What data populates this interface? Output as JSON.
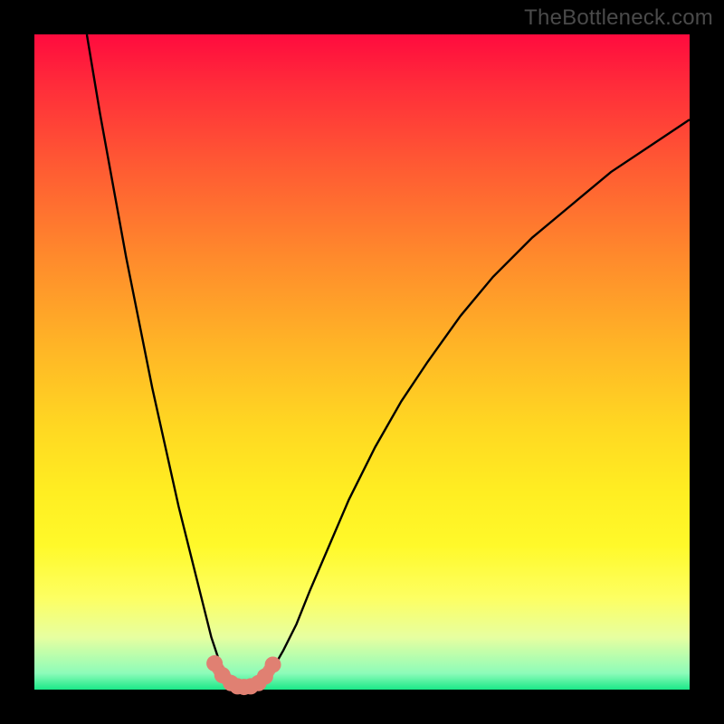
{
  "watermark": "TheBottleneck.com",
  "chart_data": {
    "type": "line",
    "title": "",
    "xlabel": "",
    "ylabel": "",
    "xlim": [
      0,
      100
    ],
    "ylim": [
      0,
      100
    ],
    "grid": false,
    "series": [
      {
        "name": "left-branch",
        "x": [
          8,
          10,
          12,
          14,
          16,
          18,
          20,
          22,
          24,
          26,
          27,
          28,
          29,
          30
        ],
        "y": [
          100,
          88,
          77,
          66,
          56,
          46,
          37,
          28,
          20,
          12,
          8,
          5,
          2.5,
          1
        ]
      },
      {
        "name": "right-branch",
        "x": [
          35,
          36,
          38,
          40,
          42,
          45,
          48,
          52,
          56,
          60,
          65,
          70,
          76,
          82,
          88,
          94,
          100
        ],
        "y": [
          1,
          2.5,
          6,
          10,
          15,
          22,
          29,
          37,
          44,
          50,
          57,
          63,
          69,
          74,
          79,
          83,
          87
        ]
      },
      {
        "name": "salmon-dots",
        "x": [
          27.5,
          28.7,
          30.0,
          31.0,
          32.0,
          33.0,
          34.2,
          35.2,
          36.4
        ],
        "y": [
          4.0,
          2.2,
          1.0,
          0.5,
          0.4,
          0.5,
          1.0,
          2.0,
          3.8
        ]
      }
    ],
    "colors": {
      "curve": "#000000",
      "dots": "#e08072"
    }
  }
}
